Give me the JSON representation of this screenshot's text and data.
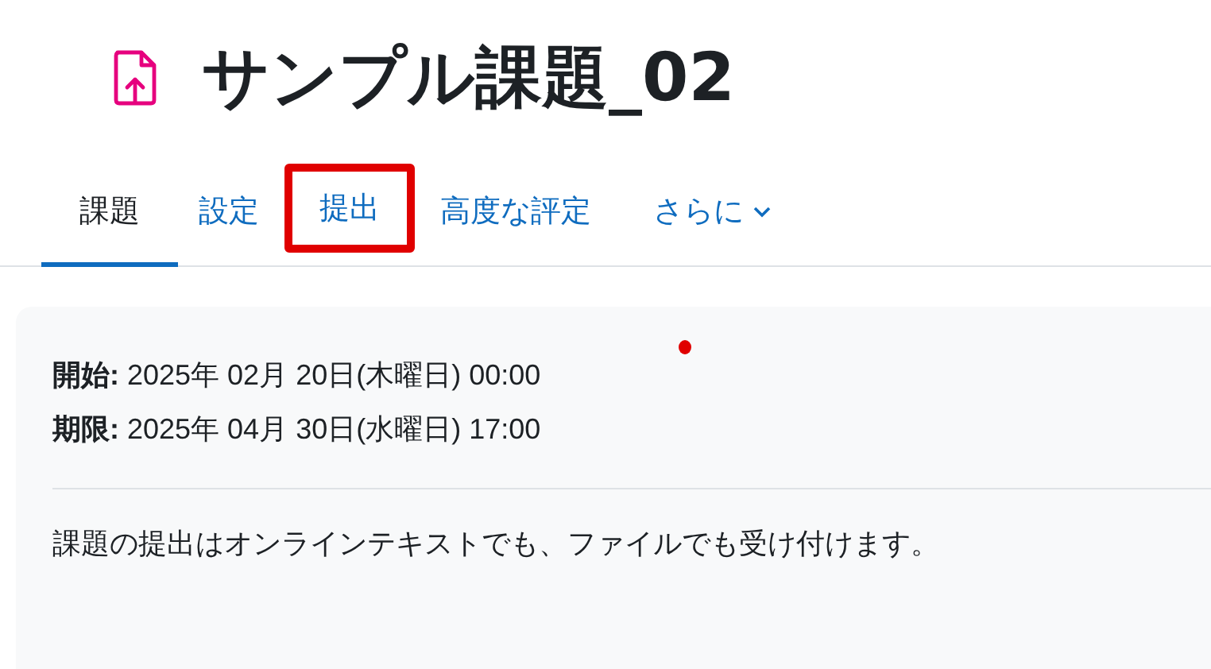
{
  "page": {
    "title": "サンプル課題_02"
  },
  "tabs": [
    {
      "label": "課題",
      "selected": true,
      "highlighted": false,
      "dropdown": false
    },
    {
      "label": "設定",
      "selected": false,
      "highlighted": false,
      "dropdown": false
    },
    {
      "label": "提出",
      "selected": false,
      "highlighted": true,
      "dropdown": false
    },
    {
      "label": "高度な評定",
      "selected": false,
      "highlighted": false,
      "dropdown": false
    },
    {
      "label": "さらに",
      "selected": false,
      "highlighted": false,
      "dropdown": true
    }
  ],
  "dates": [
    {
      "label": "開始:",
      "value": "2025年 02月 20日(木曜日) 00:00"
    },
    {
      "label": "期限:",
      "value": "2025年 04月 30日(水曜日) 17:00"
    }
  ],
  "description": "課題の提出はオンラインテキストでも、ファイルでも受け付けます。"
}
